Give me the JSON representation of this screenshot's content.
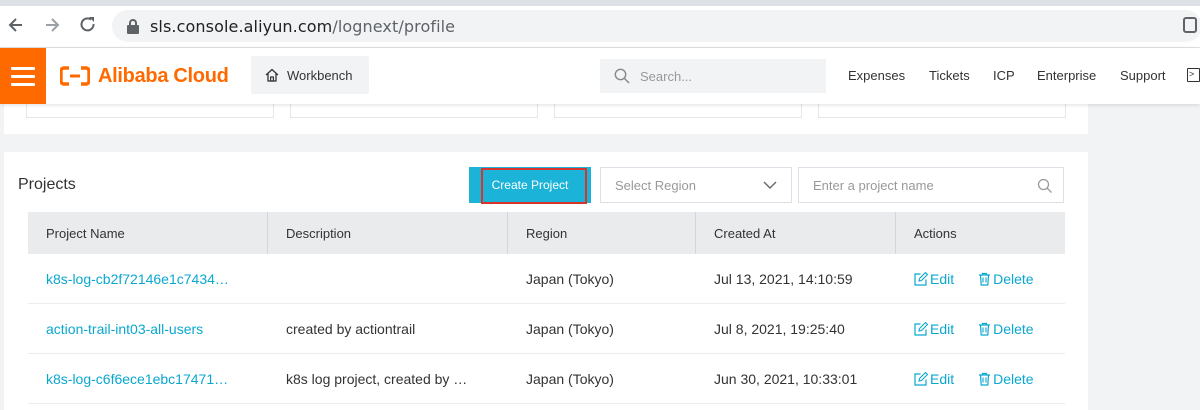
{
  "browser": {
    "url_host": "sls.console.aliyun.com",
    "url_path": "/lognext/profile",
    "icons": [
      "back-arrow-icon",
      "forward-arrow-icon",
      "reload-icon",
      "lock-icon",
      "extension-icon"
    ]
  },
  "topnav": {
    "brand": "Alibaba Cloud",
    "brand_color": "#ff6a00",
    "workbench_label": "Workbench",
    "search_placeholder": "Search...",
    "links": [
      "Expenses",
      "Tickets",
      "ICP",
      "Enterprise",
      "Support"
    ]
  },
  "projects": {
    "title": "Projects",
    "create_button": "Create Project",
    "region_placeholder": "Select Region",
    "name_placeholder": "Enter a project name",
    "columns": [
      "Project Name",
      "Description",
      "Region",
      "Created At",
      "Actions"
    ],
    "edit_label": "Edit",
    "delete_label": "Delete",
    "rows": [
      {
        "name": "k8s-log-cb2f72146e1c7434…",
        "description": "",
        "region": "Japan (Tokyo)",
        "created_at": "Jul 13, 2021, 14:10:59"
      },
      {
        "name": "action-trail-int03-all-users",
        "description": "created by actiontrail",
        "region": "Japan (Tokyo)",
        "created_at": "Jul 8, 2021, 19:25:40"
      },
      {
        "name": "k8s-log-c6f6ece1ebc17471…",
        "description": "k8s log project, created by …",
        "region": "Japan (Tokyo)",
        "created_at": "Jun 30, 2021, 10:33:01"
      }
    ],
    "accent_color": "#1cb3d9",
    "highlight_color": "#d9342b"
  }
}
